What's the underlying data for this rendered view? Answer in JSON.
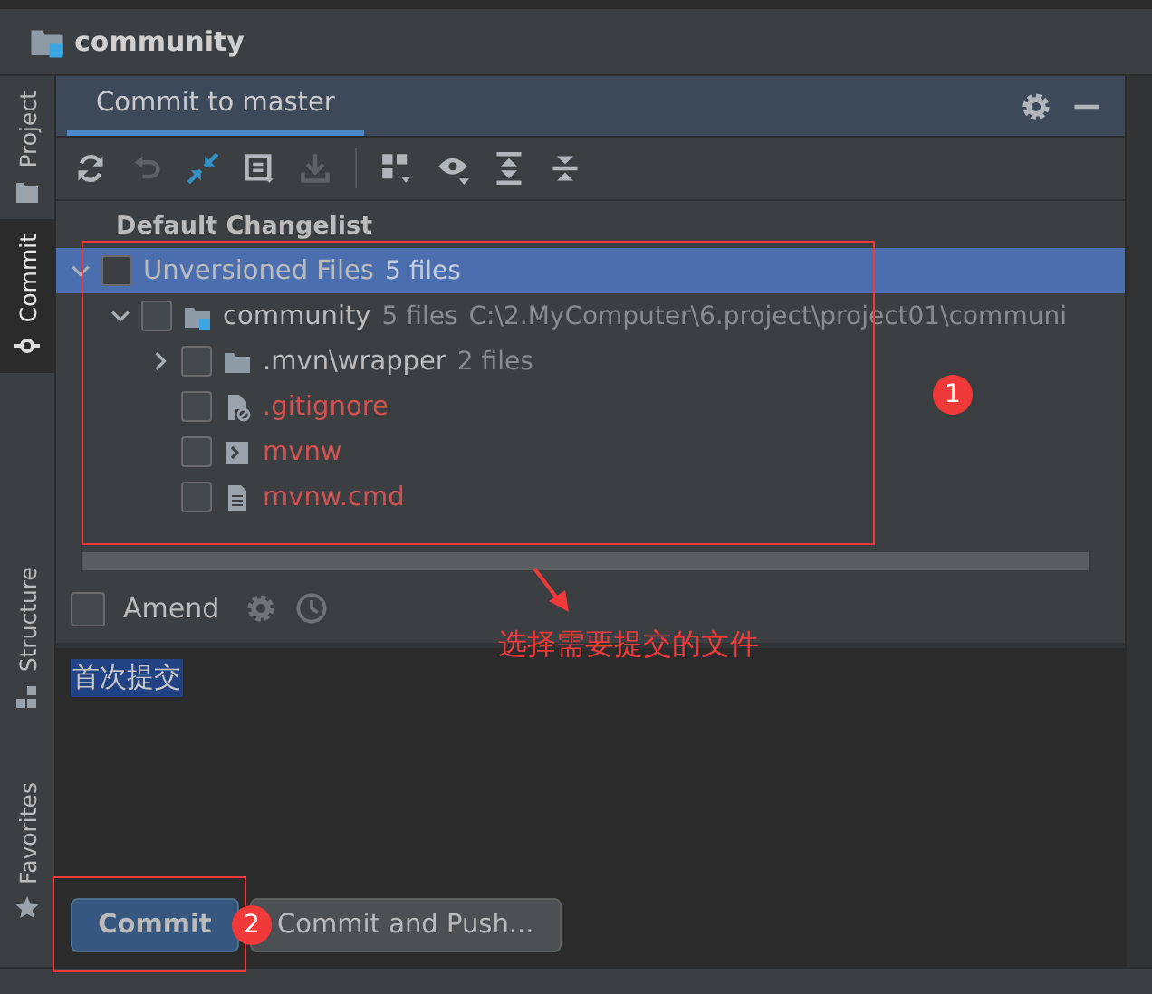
{
  "project_title": "community",
  "tool_tabs": [
    {
      "label": "Project",
      "selected": false
    },
    {
      "label": "Commit",
      "selected": true
    },
    {
      "label": "Structure",
      "selected": false
    },
    {
      "label": "Favorites",
      "selected": false
    }
  ],
  "panel_tabs": [
    {
      "label": "Commit to master",
      "selected": true
    }
  ],
  "changelist": {
    "title": "Default Changelist",
    "tree": [
      {
        "label": "Unversioned Files",
        "count": "5 files",
        "checked": false,
        "expanded": true,
        "selected": true,
        "children": [
          {
            "label": "community",
            "count": "5 files",
            "path": "C:\\2.MyComputer\\6.project\\project01\\communi",
            "kind": "module",
            "checked": false,
            "expanded": true,
            "selected": false,
            "children": [
              {
                "label": ".mvn\\wrapper",
                "count": "2 files",
                "kind": "folder",
                "checked": false,
                "expanded": false,
                "selected": false
              },
              {
                "label": ".gitignore",
                "kind": "ignore",
                "checked": false,
                "selected": false
              },
              {
                "label": "mvnw",
                "kind": "script",
                "checked": false,
                "selected": false
              },
              {
                "label": "mvnw.cmd",
                "kind": "text",
                "checked": false,
                "selected": false
              }
            ]
          }
        ]
      }
    ]
  },
  "amend": {
    "label": "Amend",
    "checked": false
  },
  "message": {
    "value": "首次提交",
    "selected": true
  },
  "buttons": [
    {
      "label": "Commit",
      "primary": true
    },
    {
      "label": "Commit and Push...",
      "primary": false
    }
  ],
  "annotations": {
    "callouts": [
      "1",
      "2"
    ],
    "note": "选择需要提交的文件"
  }
}
